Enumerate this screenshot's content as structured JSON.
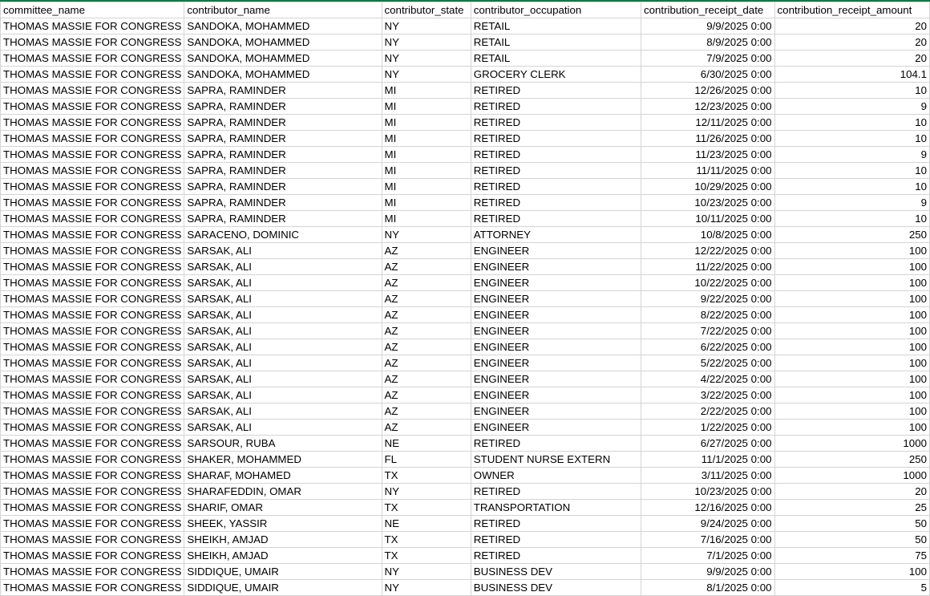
{
  "headers": [
    "committee_name",
    "contributor_name",
    "contributor_state",
    "contributor_occupation",
    "contribution_receipt_date",
    "contribution_receipt_amount"
  ],
  "rows": [
    [
      "THOMAS MASSIE FOR CONGRESS",
      "SANDOKA, MOHAMMED",
      "NY",
      "RETAIL",
      "9/9/2025 0:00",
      "20"
    ],
    [
      "THOMAS MASSIE FOR CONGRESS",
      "SANDOKA, MOHAMMED",
      "NY",
      "RETAIL",
      "8/9/2025 0:00",
      "20"
    ],
    [
      "THOMAS MASSIE FOR CONGRESS",
      "SANDOKA, MOHAMMED",
      "NY",
      "RETAIL",
      "7/9/2025 0:00",
      "20"
    ],
    [
      "THOMAS MASSIE FOR CONGRESS",
      "SANDOKA, MOHAMMED",
      "NY",
      "GROCERY CLERK",
      "6/30/2025 0:00",
      "104.1"
    ],
    [
      "THOMAS MASSIE FOR CONGRESS",
      "SAPRA, RAMINDER",
      "MI",
      "RETIRED",
      "12/26/2025 0:00",
      "10"
    ],
    [
      "THOMAS MASSIE FOR CONGRESS",
      "SAPRA, RAMINDER",
      "MI",
      "RETIRED",
      "12/23/2025 0:00",
      "9"
    ],
    [
      "THOMAS MASSIE FOR CONGRESS",
      "SAPRA, RAMINDER",
      "MI",
      "RETIRED",
      "12/11/2025 0:00",
      "10"
    ],
    [
      "THOMAS MASSIE FOR CONGRESS",
      "SAPRA, RAMINDER",
      "MI",
      "RETIRED",
      "11/26/2025 0:00",
      "10"
    ],
    [
      "THOMAS MASSIE FOR CONGRESS",
      "SAPRA, RAMINDER",
      "MI",
      "RETIRED",
      "11/23/2025 0:00",
      "9"
    ],
    [
      "THOMAS MASSIE FOR CONGRESS",
      "SAPRA, RAMINDER",
      "MI",
      "RETIRED",
      "11/11/2025 0:00",
      "10"
    ],
    [
      "THOMAS MASSIE FOR CONGRESS",
      "SAPRA, RAMINDER",
      "MI",
      "RETIRED",
      "10/29/2025 0:00",
      "10"
    ],
    [
      "THOMAS MASSIE FOR CONGRESS",
      "SAPRA, RAMINDER",
      "MI",
      "RETIRED",
      "10/23/2025 0:00",
      "9"
    ],
    [
      "THOMAS MASSIE FOR CONGRESS",
      "SAPRA, RAMINDER",
      "MI",
      "RETIRED",
      "10/11/2025 0:00",
      "10"
    ],
    [
      "THOMAS MASSIE FOR CONGRESS",
      "SARACENO, DOMINIC",
      "NY",
      "ATTORNEY",
      "10/8/2025 0:00",
      "250"
    ],
    [
      "THOMAS MASSIE FOR CONGRESS",
      "SARSAK, ALI",
      "AZ",
      "ENGINEER",
      "12/22/2025 0:00",
      "100"
    ],
    [
      "THOMAS MASSIE FOR CONGRESS",
      "SARSAK, ALI",
      "AZ",
      "ENGINEER",
      "11/22/2025 0:00",
      "100"
    ],
    [
      "THOMAS MASSIE FOR CONGRESS",
      "SARSAK, ALI",
      "AZ",
      "ENGINEER",
      "10/22/2025 0:00",
      "100"
    ],
    [
      "THOMAS MASSIE FOR CONGRESS",
      "SARSAK, ALI",
      "AZ",
      "ENGINEER",
      "9/22/2025 0:00",
      "100"
    ],
    [
      "THOMAS MASSIE FOR CONGRESS",
      "SARSAK, ALI",
      "AZ",
      "ENGINEER",
      "8/22/2025 0:00",
      "100"
    ],
    [
      "THOMAS MASSIE FOR CONGRESS",
      "SARSAK, ALI",
      "AZ",
      "ENGINEER",
      "7/22/2025 0:00",
      "100"
    ],
    [
      "THOMAS MASSIE FOR CONGRESS",
      "SARSAK, ALI",
      "AZ",
      "ENGINEER",
      "6/22/2025 0:00",
      "100"
    ],
    [
      "THOMAS MASSIE FOR CONGRESS",
      "SARSAK, ALI",
      "AZ",
      "ENGINEER",
      "5/22/2025 0:00",
      "100"
    ],
    [
      "THOMAS MASSIE FOR CONGRESS",
      "SARSAK, ALI",
      "AZ",
      "ENGINEER",
      "4/22/2025 0:00",
      "100"
    ],
    [
      "THOMAS MASSIE FOR CONGRESS",
      "SARSAK, ALI",
      "AZ",
      "ENGINEER",
      "3/22/2025 0:00",
      "100"
    ],
    [
      "THOMAS MASSIE FOR CONGRESS",
      "SARSAK, ALI",
      "AZ",
      "ENGINEER",
      "2/22/2025 0:00",
      "100"
    ],
    [
      "THOMAS MASSIE FOR CONGRESS",
      "SARSAK, ALI",
      "AZ",
      "ENGINEER",
      "1/22/2025 0:00",
      "100"
    ],
    [
      "THOMAS MASSIE FOR CONGRESS",
      "SARSOUR, RUBA",
      "NE",
      "RETIRED",
      "6/27/2025 0:00",
      "1000"
    ],
    [
      "THOMAS MASSIE FOR CONGRESS",
      "SHAKER, MOHAMMED",
      "FL",
      "STUDENT NURSE EXTERN",
      "11/1/2025 0:00",
      "250"
    ],
    [
      "THOMAS MASSIE FOR CONGRESS",
      "SHARAF, MOHAMED",
      "TX",
      "OWNER",
      "3/11/2025 0:00",
      "1000"
    ],
    [
      "THOMAS MASSIE FOR CONGRESS",
      "SHARAFEDDIN, OMAR",
      "NY",
      "RETIRED",
      "10/23/2025 0:00",
      "20"
    ],
    [
      "THOMAS MASSIE FOR CONGRESS",
      "SHARIF, OMAR",
      "TX",
      "TRANSPORTATION",
      "12/16/2025 0:00",
      "25"
    ],
    [
      "THOMAS MASSIE FOR CONGRESS",
      "SHEEK, YASSIR",
      "NE",
      "RETIRED",
      "9/24/2025 0:00",
      "50"
    ],
    [
      "THOMAS MASSIE FOR CONGRESS",
      "SHEIKH, AMJAD",
      "TX",
      "RETIRED",
      "7/16/2025 0:00",
      "50"
    ],
    [
      "THOMAS MASSIE FOR CONGRESS",
      "SHEIKH, AMJAD",
      "TX",
      "RETIRED",
      "7/1/2025 0:00",
      "75"
    ],
    [
      "THOMAS MASSIE FOR CONGRESS",
      "SIDDIQUE, UMAIR",
      "NY",
      "BUSINESS DEV",
      "9/9/2025 0:00",
      "100"
    ],
    [
      "THOMAS MASSIE FOR CONGRESS",
      "SIDDIQUE, UMAIR",
      "NY",
      "BUSINESS DEV",
      "8/1/2025 0:00",
      "5"
    ]
  ]
}
